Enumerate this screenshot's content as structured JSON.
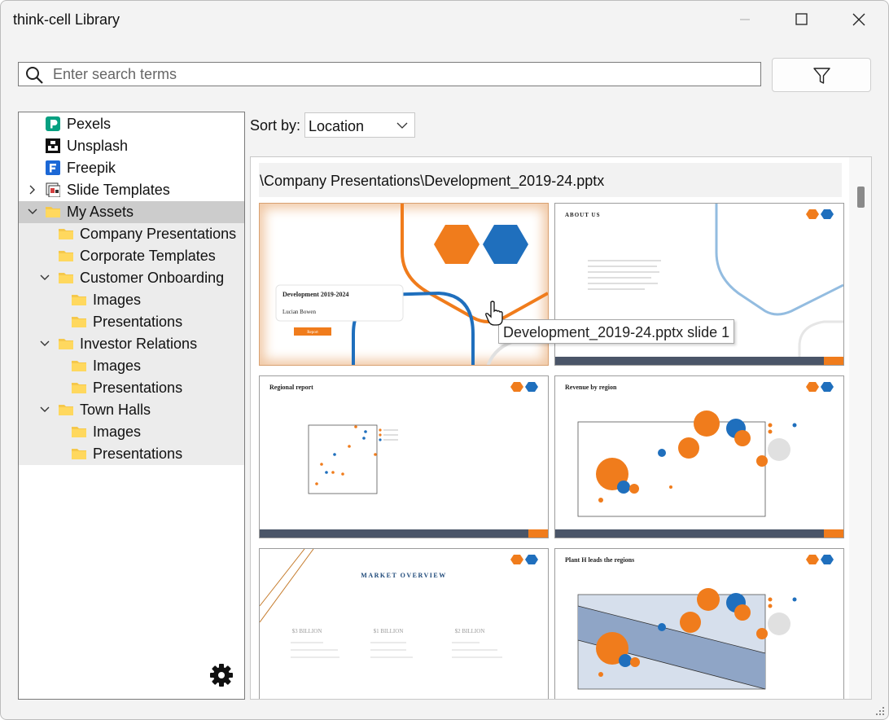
{
  "window": {
    "title": "think-cell Library"
  },
  "search": {
    "placeholder": "Enter search terms"
  },
  "tree": {
    "items": [
      {
        "label": "Pexels"
      },
      {
        "label": "Unsplash"
      },
      {
        "label": "Freepik"
      },
      {
        "label": "Slide Templates"
      },
      {
        "label": "My Assets"
      },
      {
        "label": "Company Presentations"
      },
      {
        "label": "Corporate Templates"
      },
      {
        "label": "Customer Onboarding"
      },
      {
        "label": "Images"
      },
      {
        "label": "Presentations"
      },
      {
        "label": "Investor Relations"
      },
      {
        "label": "Images"
      },
      {
        "label": "Presentations"
      },
      {
        "label": "Town Halls"
      },
      {
        "label": "Images"
      },
      {
        "label": "Presentations"
      }
    ]
  },
  "sort": {
    "label": "Sort by:",
    "selected": "Location"
  },
  "content": {
    "path": "\\Company Presentations\\Development_2019-24.pptx",
    "tooltip": "Development_2019-24.pptx slide 1"
  },
  "slides": [
    {
      "title": "Development 2019-2024",
      "author": "Lucian Bowen",
      "button": "Report"
    },
    {
      "title": "ABOUT US"
    },
    {
      "title": "Regional report"
    },
    {
      "title": "Revenue by region"
    },
    {
      "title": "MARKET OVERVIEW",
      "figures": [
        "$3 BILLION",
        "$1 BILLION",
        "$2 BILLION"
      ]
    },
    {
      "title": "Plant H leads the regions"
    }
  ],
  "colors": {
    "accent_orange": "#f07c1c",
    "accent_blue": "#1f6fbd",
    "footer_bar": "#4a5568",
    "selection": "#cccccc"
  }
}
